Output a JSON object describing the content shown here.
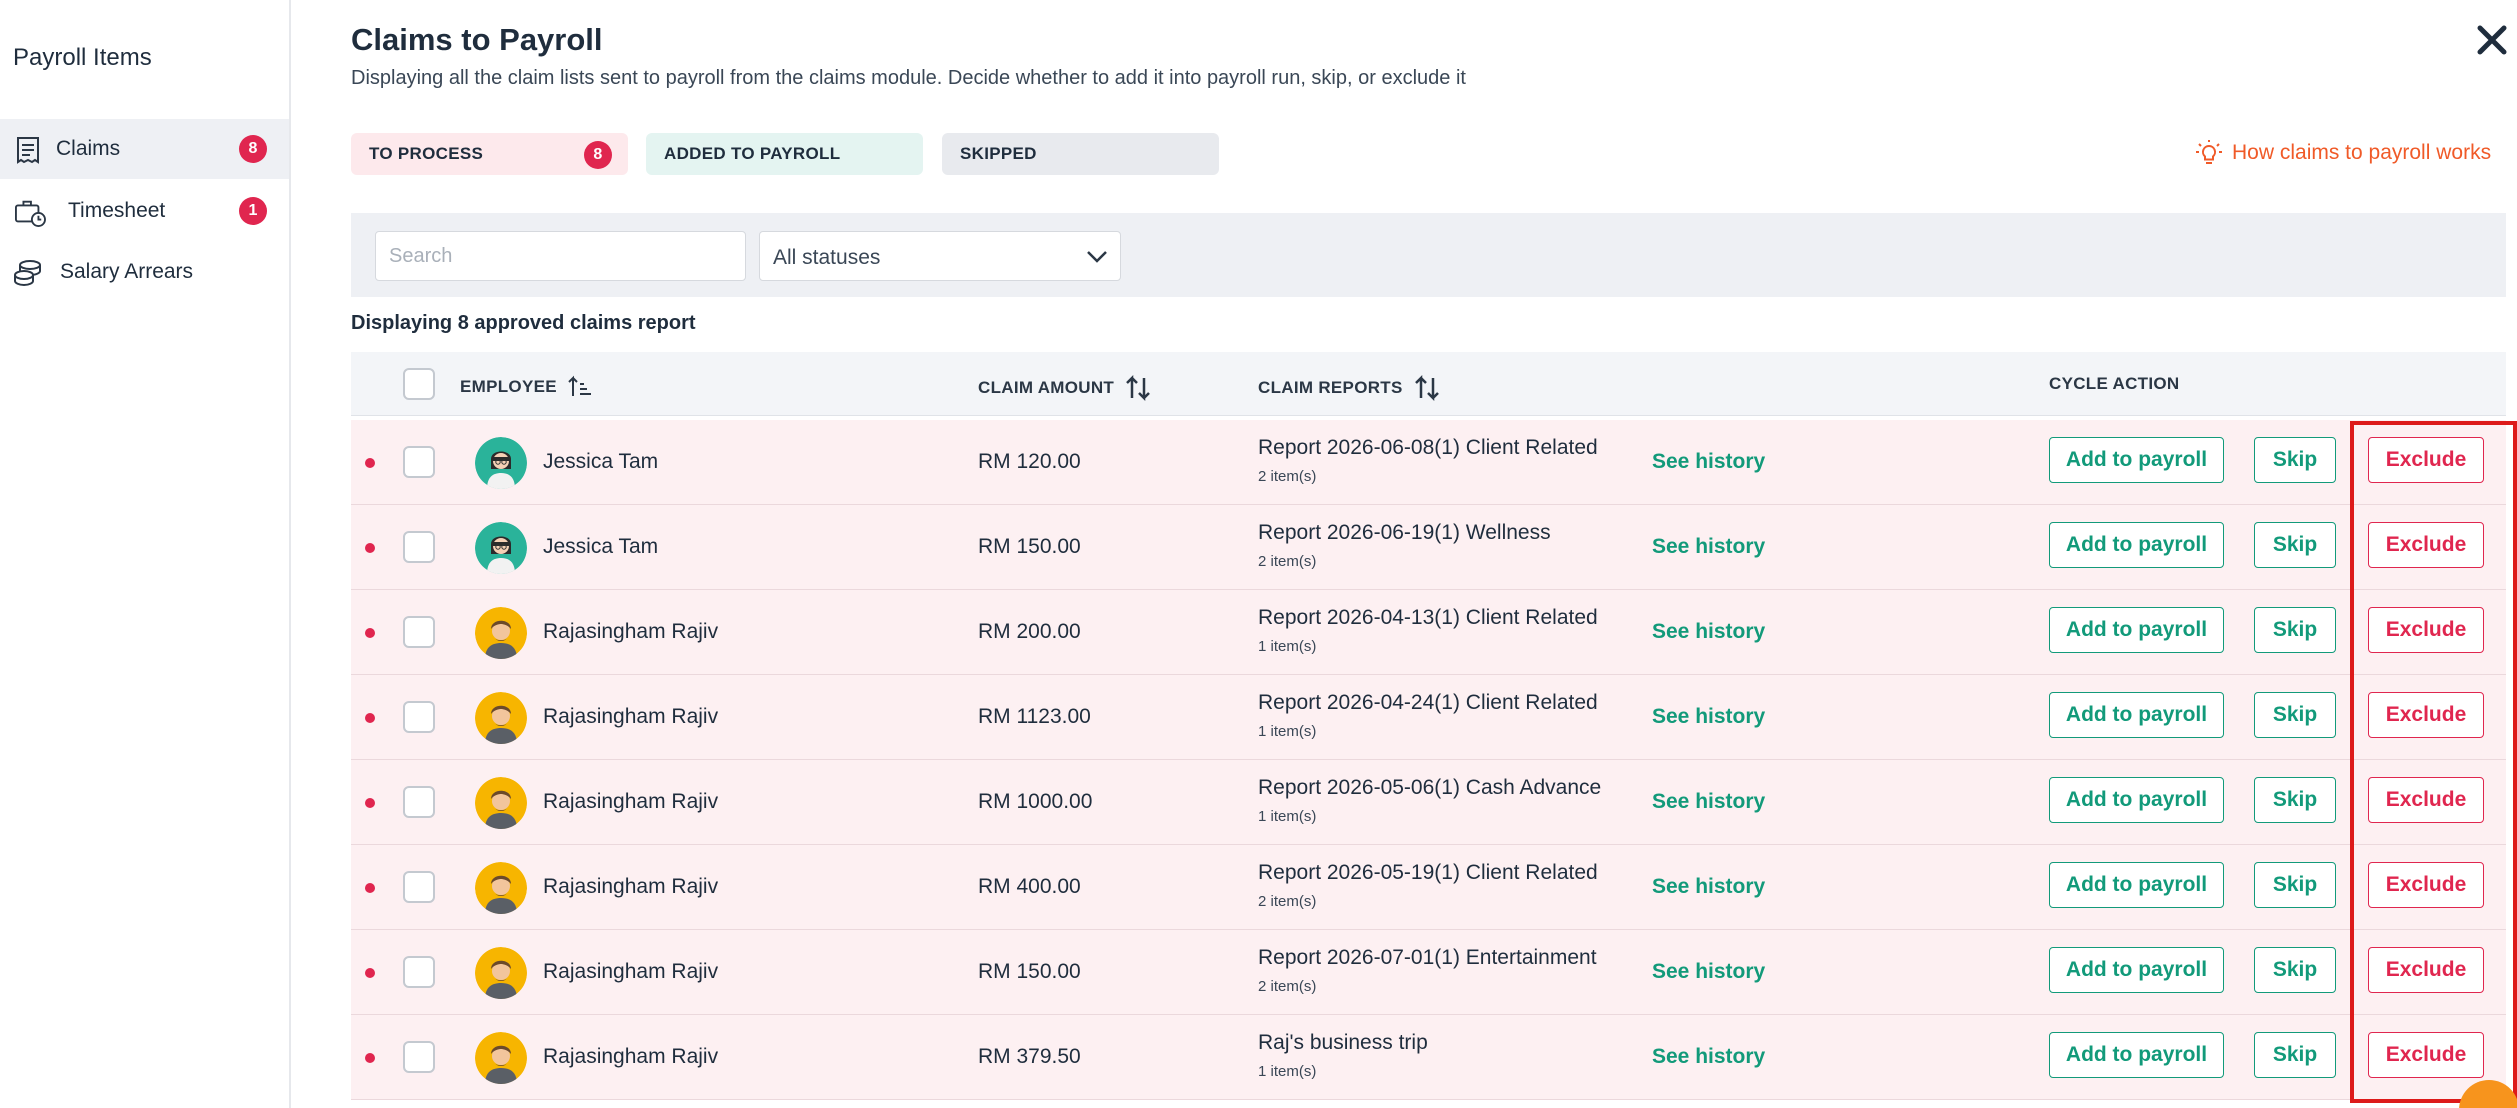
{
  "sidebar": {
    "title": "Payroll Items",
    "items": [
      {
        "label": "Claims",
        "badge": "8",
        "icon": "receipt-icon"
      },
      {
        "label": "Timesheet",
        "badge": "1",
        "icon": "timesheet-clock-icon"
      },
      {
        "label": "Salary Arrears",
        "badge": "",
        "icon": "coin-stack-icon"
      }
    ]
  },
  "header": {
    "title": "Claims to Payroll",
    "subtitle": "Displaying all the claim lists sent to payroll from the claims module. Decide whether to add it into payroll run, skip, or exclude it"
  },
  "tabs": [
    {
      "label": "TO PROCESS",
      "badge": "8"
    },
    {
      "label": "ADDED TO PAYROLL",
      "badge": ""
    },
    {
      "label": "SKIPPED",
      "badge": ""
    }
  ],
  "help_link": "How claims to payroll works",
  "filters": {
    "search_placeholder": "Search",
    "status_value": "All statuses"
  },
  "count_text": "Displaying 8 approved claims report",
  "table": {
    "columns": {
      "employee": "EMPLOYEE",
      "amount": "CLAIM AMOUNT",
      "reports": "CLAIM REPORTS",
      "action": "CYCLE ACTION"
    },
    "row_actions": {
      "history": "See history",
      "add": "Add to payroll",
      "skip": "Skip",
      "exclude": "Exclude"
    },
    "rows": [
      {
        "name": "Jessica Tam",
        "amount": "RM 120.00",
        "report": "Report 2026-06-08(1) Client Related",
        "items": "2 item(s)",
        "avatar": "female"
      },
      {
        "name": "Jessica Tam",
        "amount": "RM 150.00",
        "report": "Report 2026-06-19(1) Wellness",
        "items": "2 item(s)",
        "avatar": "female"
      },
      {
        "name": "Rajasingham Rajiv",
        "amount": "RM 200.00",
        "report": "Report 2026-04-13(1) Client Related",
        "items": "1 item(s)",
        "avatar": "male"
      },
      {
        "name": "Rajasingham Rajiv",
        "amount": "RM 1123.00",
        "report": "Report 2026-04-24(1) Client Related",
        "items": "1 item(s)",
        "avatar": "male"
      },
      {
        "name": "Rajasingham Rajiv",
        "amount": "RM 1000.00",
        "report": "Report 2026-05-06(1) Cash Advance",
        "items": "1 item(s)",
        "avatar": "male"
      },
      {
        "name": "Rajasingham Rajiv",
        "amount": "RM 400.00",
        "report": "Report 2026-05-19(1) Client Related",
        "items": "2 item(s)",
        "avatar": "male"
      },
      {
        "name": "Rajasingham Rajiv",
        "amount": "RM 150.00",
        "report": "Report 2026-07-01(1) Entertainment",
        "items": "2 item(s)",
        "avatar": "male"
      },
      {
        "name": "Rajasingham Rajiv",
        "amount": "RM 379.50",
        "report": "Raj's business trip",
        "items": "1 item(s)",
        "avatar": "male"
      }
    ]
  },
  "colors": {
    "accent_green": "#129a7a",
    "danger_red": "#e0264f",
    "help_orange": "#f05a28"
  }
}
